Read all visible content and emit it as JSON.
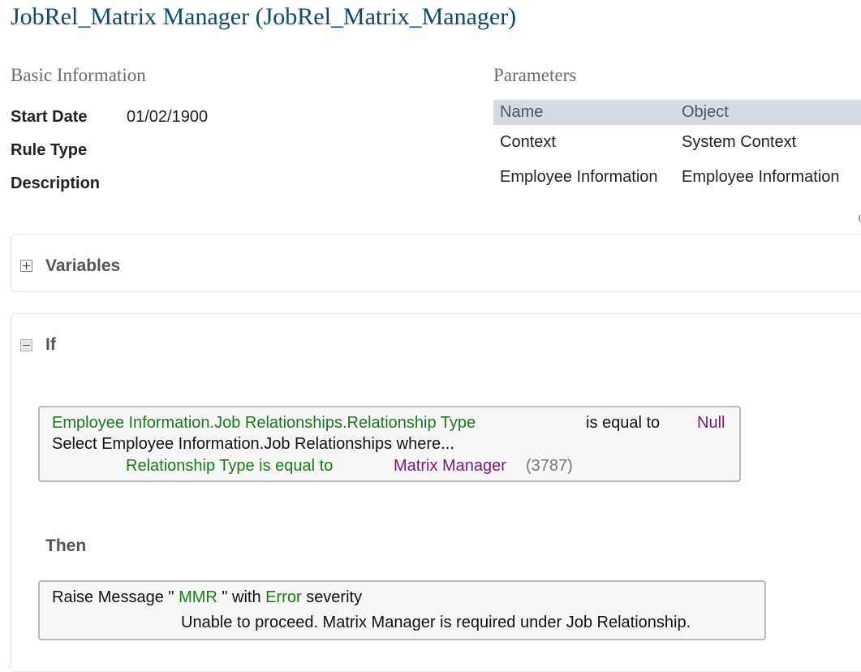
{
  "title": "JobRel_Matrix Manager (JobRel_Matrix_Manager)",
  "basic_info": {
    "heading": "Basic Information",
    "start_date_label": "Start Date",
    "start_date_value": "01/02/1900",
    "rule_type_label": "Rule Type",
    "rule_type_value": "",
    "description_label": "Description",
    "description_value": ""
  },
  "parameters": {
    "heading": "Parameters",
    "columns": [
      "Name",
      "Object"
    ],
    "rows": [
      {
        "name": "Context",
        "object": "System Context"
      },
      {
        "name": "Employee Information",
        "object": "Employee Information"
      }
    ]
  },
  "variables": {
    "title": "Variables"
  },
  "if_block": {
    "title": "If",
    "condition": {
      "field": "Employee Information.Job Relationships.Relationship Type",
      "operator": "is equal to",
      "value": "Null",
      "select_text": "Select Employee Information.Job Relationships where...",
      "sub_condition": "Relationship Type is equal to",
      "sub_value": "Matrix Manager",
      "sub_id": "(3787)"
    }
  },
  "then_block": {
    "title": "Then",
    "action": {
      "prefix": "Raise Message",
      "open_quote": " \" ",
      "message_key": "MMR",
      "close_with": " \" with ",
      "severity": "Error",
      "suffix": "severity",
      "message_text": "Unable to proceed. Matrix Manager is required under Job Relationship."
    }
  },
  "colors": {
    "title": "#0e4a6b",
    "field_green": "#1a7a1a",
    "value_purple": "#7a1a7a",
    "table_header": "#d4dce3"
  }
}
